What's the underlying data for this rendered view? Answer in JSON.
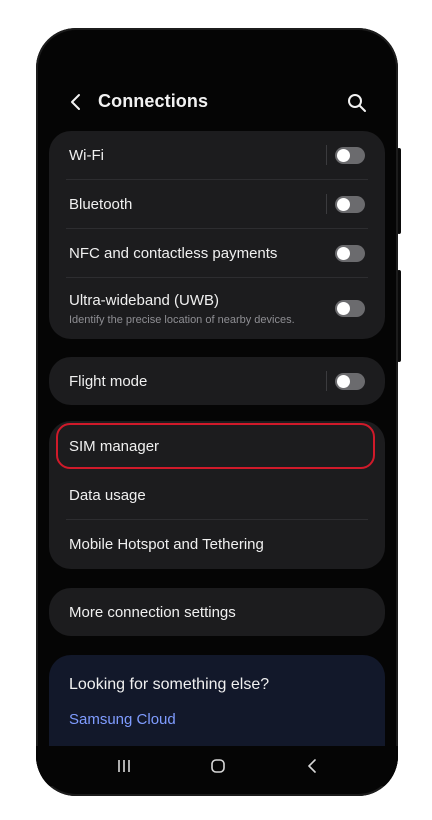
{
  "header": {
    "title": "Connections"
  },
  "group1": [
    {
      "label": "Wi-Fi",
      "toggle_on": false
    },
    {
      "label": "Bluetooth",
      "toggle_on": false
    },
    {
      "label": "NFC and contactless payments",
      "toggle_on": false
    },
    {
      "label": "Ultra-wideband (UWB)",
      "subtitle": "Identify the precise location of nearby devices.",
      "toggle_on": false
    }
  ],
  "group2": [
    {
      "label": "Flight mode",
      "toggle_on": false
    }
  ],
  "group3": [
    {
      "label": "SIM manager",
      "highlighted": true
    },
    {
      "label": "Data usage"
    },
    {
      "label": "Mobile Hotspot and Tethering"
    }
  ],
  "group4": [
    {
      "label": "More connection settings"
    }
  ],
  "help": {
    "title": "Looking for something else?",
    "link": "Samsung Cloud"
  },
  "colors": {
    "highlight": "#d01a2a",
    "link": "#7f9cff",
    "card": "#1c1c1e"
  },
  "icons": {
    "back": "chevron-left-icon",
    "search": "search-icon",
    "recents": "recents-icon",
    "home": "home-icon",
    "nav_back": "nav-back-icon"
  }
}
